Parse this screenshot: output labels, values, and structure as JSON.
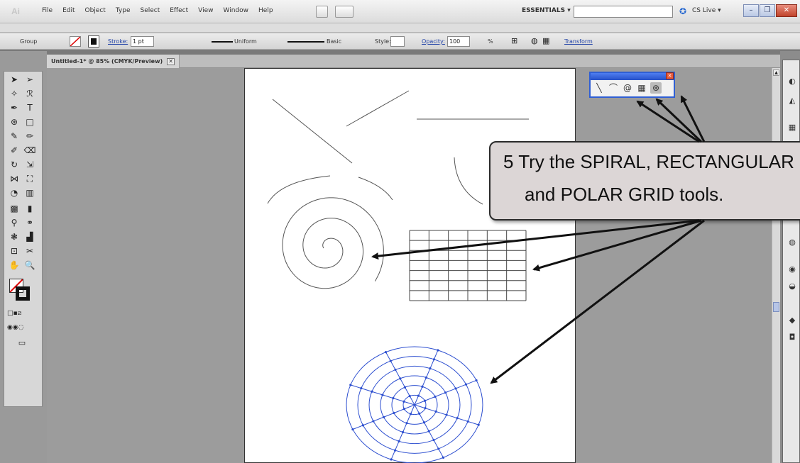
{
  "app": {
    "logo": "Ai"
  },
  "menu": {
    "items": [
      "File",
      "Edit",
      "Object",
      "Type",
      "Select",
      "Effect",
      "View",
      "Window",
      "Help"
    ]
  },
  "workspace": {
    "label": "ESSENTIALS ▾",
    "search_placeholder": "",
    "cslive": "CS Live ▾"
  },
  "window_buttons": {
    "minimize": "–",
    "restore": "❐",
    "close": "✕"
  },
  "control_bar": {
    "selection": "Group",
    "stroke_label": "Stroke:",
    "stroke_value": "1 pt",
    "profile_label": "Uniform",
    "brush_label": "Basic",
    "style_label": "Style:",
    "opacity_label": "Opacity:",
    "opacity_value": "100",
    "percent": "%",
    "transform_link": "Transform"
  },
  "document_tab": {
    "title": "Untitled-1* @ 85% (CMYK/Preview)",
    "close": "✕"
  },
  "tearoff_panel": {
    "close": "✕",
    "icons": [
      "line-segment-icon",
      "arc-icon",
      "spiral-icon",
      "rectangular-grid-icon",
      "polar-grid-icon"
    ]
  },
  "callout": {
    "line1": "5  Try the SPIRAL, RECTANGULAR",
    "line2": "and POLAR GRID tools."
  },
  "colors": {
    "accent": "#2f5fd4",
    "callout_bg": "#dcd6d6",
    "polar_grid": "#2d4fd0"
  }
}
